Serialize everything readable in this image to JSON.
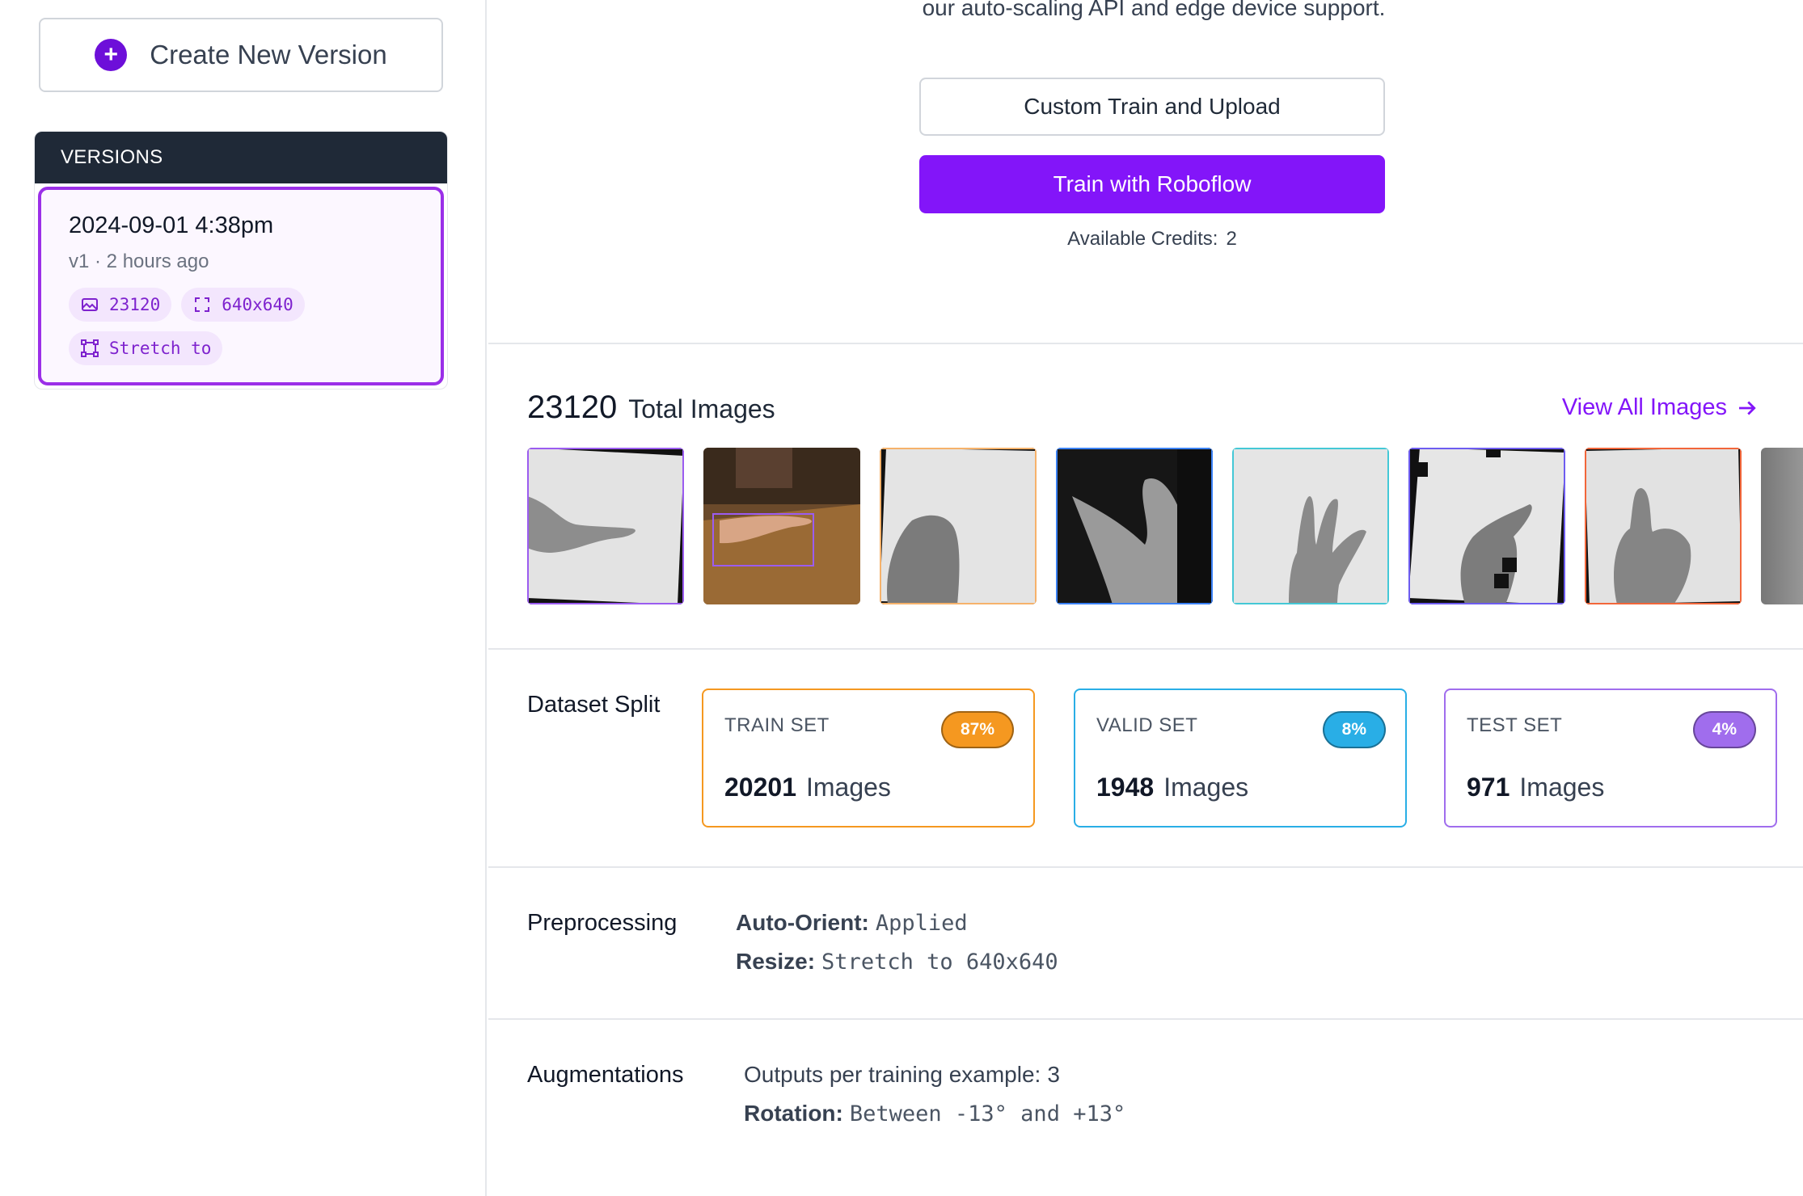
{
  "sidebar": {
    "create_label": "Create New Version",
    "versions_header": "VERSIONS",
    "version": {
      "date": "2024-09-01 4:38pm",
      "subtitle": "v1 · 2 hours ago",
      "chips": [
        "23120",
        "640x640",
        "Stretch to"
      ]
    }
  },
  "main": {
    "intro": "our auto-scaling API and edge device support.",
    "custom_train_label": "Custom Train and Upload",
    "train_roboflow_label": "Train with Roboflow",
    "credits_label": "Available Credits:",
    "credits_value": "2",
    "total_count": "23120",
    "total_label": "Total Images",
    "view_all_label": "View All Images",
    "dataset_split_label": "Dataset Split",
    "splits": [
      {
        "name": "TRAIN SET",
        "percent": "87%",
        "count": "20201",
        "unit": "Images",
        "color": "#f59820"
      },
      {
        "name": "VALID SET",
        "percent": "8%",
        "count": "1948",
        "unit": "Images",
        "color": "#29aee6"
      },
      {
        "name": "TEST SET",
        "percent": "4%",
        "count": "971",
        "unit": "Images",
        "color": "#a06ded"
      }
    ],
    "preprocessing_label": "Preprocessing",
    "preprocessing": [
      {
        "key": "Auto-Orient:",
        "value": "Applied"
      },
      {
        "key": "Resize:",
        "value": "Stretch to 640x640"
      }
    ],
    "augmentations_label": "Augmentations",
    "augmentations": [
      {
        "key": "Outputs per training example:",
        "value": "3"
      },
      {
        "key": "Rotation:",
        "value": "Between -13° and +13°"
      }
    ]
  },
  "colors": {
    "accent": "#8315f9",
    "sidebar_dark": "#1f2937",
    "selected_border": "#9b2fe8"
  },
  "icons": {
    "create": "plus-circle-icon",
    "chip_images": "image-icon",
    "chip_size": "expand-icon",
    "chip_resize": "resize-icon",
    "view_all": "arrow-right-icon"
  }
}
